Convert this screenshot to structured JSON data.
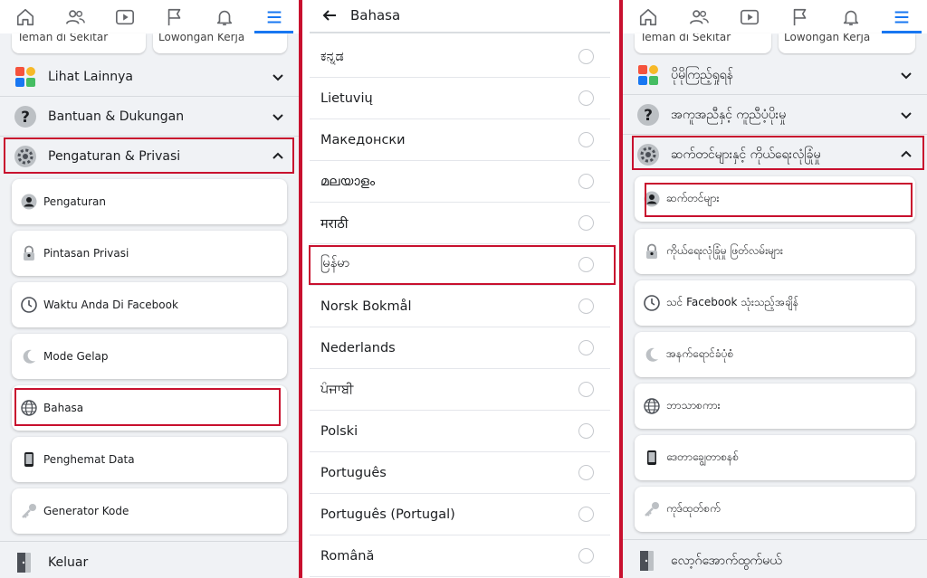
{
  "colors": {
    "accent": "#1877f2",
    "highlight": "#c8102e",
    "background": "#f0f2f5"
  },
  "nav_icons": [
    "home-icon",
    "friends-icon",
    "watch-icon",
    "pages-flag-icon",
    "notifications-bell-icon",
    "menu-icon"
  ],
  "panel_id": {
    "peek": [
      "Teman di Sekitar",
      "Lowongan Kerja"
    ],
    "sections": {
      "more": "Lihat Lainnya",
      "help": "Bantuan & Dukungan",
      "settings": "Pengaturan & Privasi"
    },
    "cards": [
      {
        "icon": "account-icon",
        "label": "Pengaturan"
      },
      {
        "icon": "privacy-lock-icon",
        "label": "Pintasan Privasi"
      },
      {
        "icon": "clock-icon",
        "label": "Waktu Anda Di Facebook"
      },
      {
        "icon": "moon-icon",
        "label": "Mode Gelap"
      },
      {
        "icon": "globe-icon",
        "label": "Bahasa"
      },
      {
        "icon": "phone-icon",
        "label": "Penghemat Data"
      },
      {
        "icon": "key-icon",
        "label": "Generator Kode"
      }
    ],
    "logout": "Keluar"
  },
  "language_panel": {
    "title": "Bahasa",
    "languages": [
      "ಕನ್ನಡ",
      "Lietuvių",
      "Македонски",
      "മലയാളം",
      "मराठी",
      "မြန်မာ",
      "Norsk Bokmål",
      "Nederlands",
      "ਪੰਜਾਬੀ",
      "Polski",
      "Português",
      "Português (Portugal)",
      "Română"
    ]
  },
  "panel_my": {
    "peek": [
      "Teman di Sekitar",
      "Lowongan Kerja"
    ],
    "sections": {
      "more": "ပိုမိုကြည့်ရှုရန်",
      "help": "အကူအညီနှင့် ကူညီပံ့ပိုးမှု",
      "settings": "ဆက်တင်များနှင့် ကိုယ်ရေးလုံခြုံမှု"
    },
    "cards": [
      {
        "icon": "account-icon",
        "label": "ဆက်တင်များ"
      },
      {
        "icon": "privacy-lock-icon",
        "label": "ကိုယ်ရေးလုံခြုံမှု ဖြတ်လမ်းများ"
      },
      {
        "icon": "clock-icon",
        "label": "သင် Facebook သုံးသည့်အချိန်"
      },
      {
        "icon": "moon-icon",
        "label": "အနက်ရောင်ခံပုံစံ"
      },
      {
        "icon": "globe-icon",
        "label": "ဘာသာစကား"
      },
      {
        "icon": "phone-icon",
        "label": "ဒေတာချွေတာစနစ်"
      },
      {
        "icon": "key-icon",
        "label": "ကုဒ်ထုတ်စက်"
      }
    ],
    "logout": "လော့ဂ်အောက်ထွက်မယ်"
  }
}
